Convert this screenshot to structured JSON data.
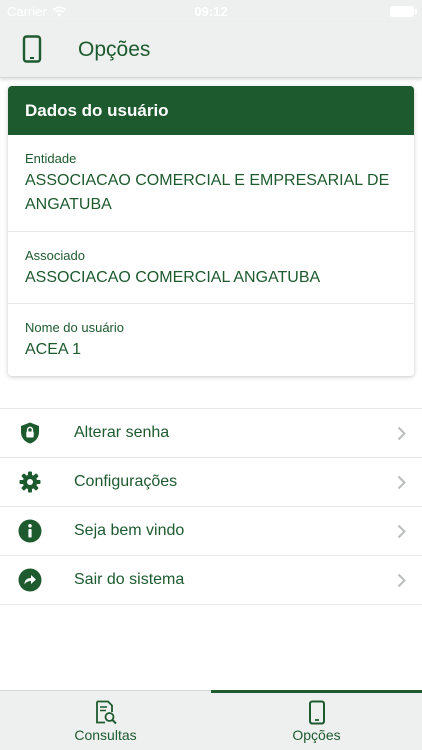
{
  "status_bar": {
    "carrier": "Carrier",
    "time": "09:12"
  },
  "nav": {
    "title": "Opções",
    "icon": "phone-icon"
  },
  "user_card": {
    "title": "Dados do usuário",
    "fields": [
      {
        "label": "Entidade",
        "value": "ASSOCIACAO COMERCIAL E EMPRESARIAL DE ANGATUBA"
      },
      {
        "label": "Associado",
        "value": "ASSOCIACAO COMERCIAL ANGATUBA"
      },
      {
        "label": "Nome do usuário",
        "value": "ACEA 1"
      }
    ]
  },
  "menu": {
    "items": [
      {
        "label": "Alterar senha",
        "icon": "shield-lock-icon"
      },
      {
        "label": "Configurações",
        "icon": "gear-icon"
      },
      {
        "label": "Seja bem vindo",
        "icon": "info-icon"
      },
      {
        "label": "Sair do sistema",
        "icon": "logout-arrow-icon"
      }
    ]
  },
  "tabs": [
    {
      "label": "Consultas",
      "icon": "document-search-icon",
      "active": false
    },
    {
      "label": "Opções",
      "icon": "phone-icon",
      "active": true
    }
  ],
  "colors": {
    "primary": "#1d5a2e",
    "bar_background": "#eef0ef"
  }
}
